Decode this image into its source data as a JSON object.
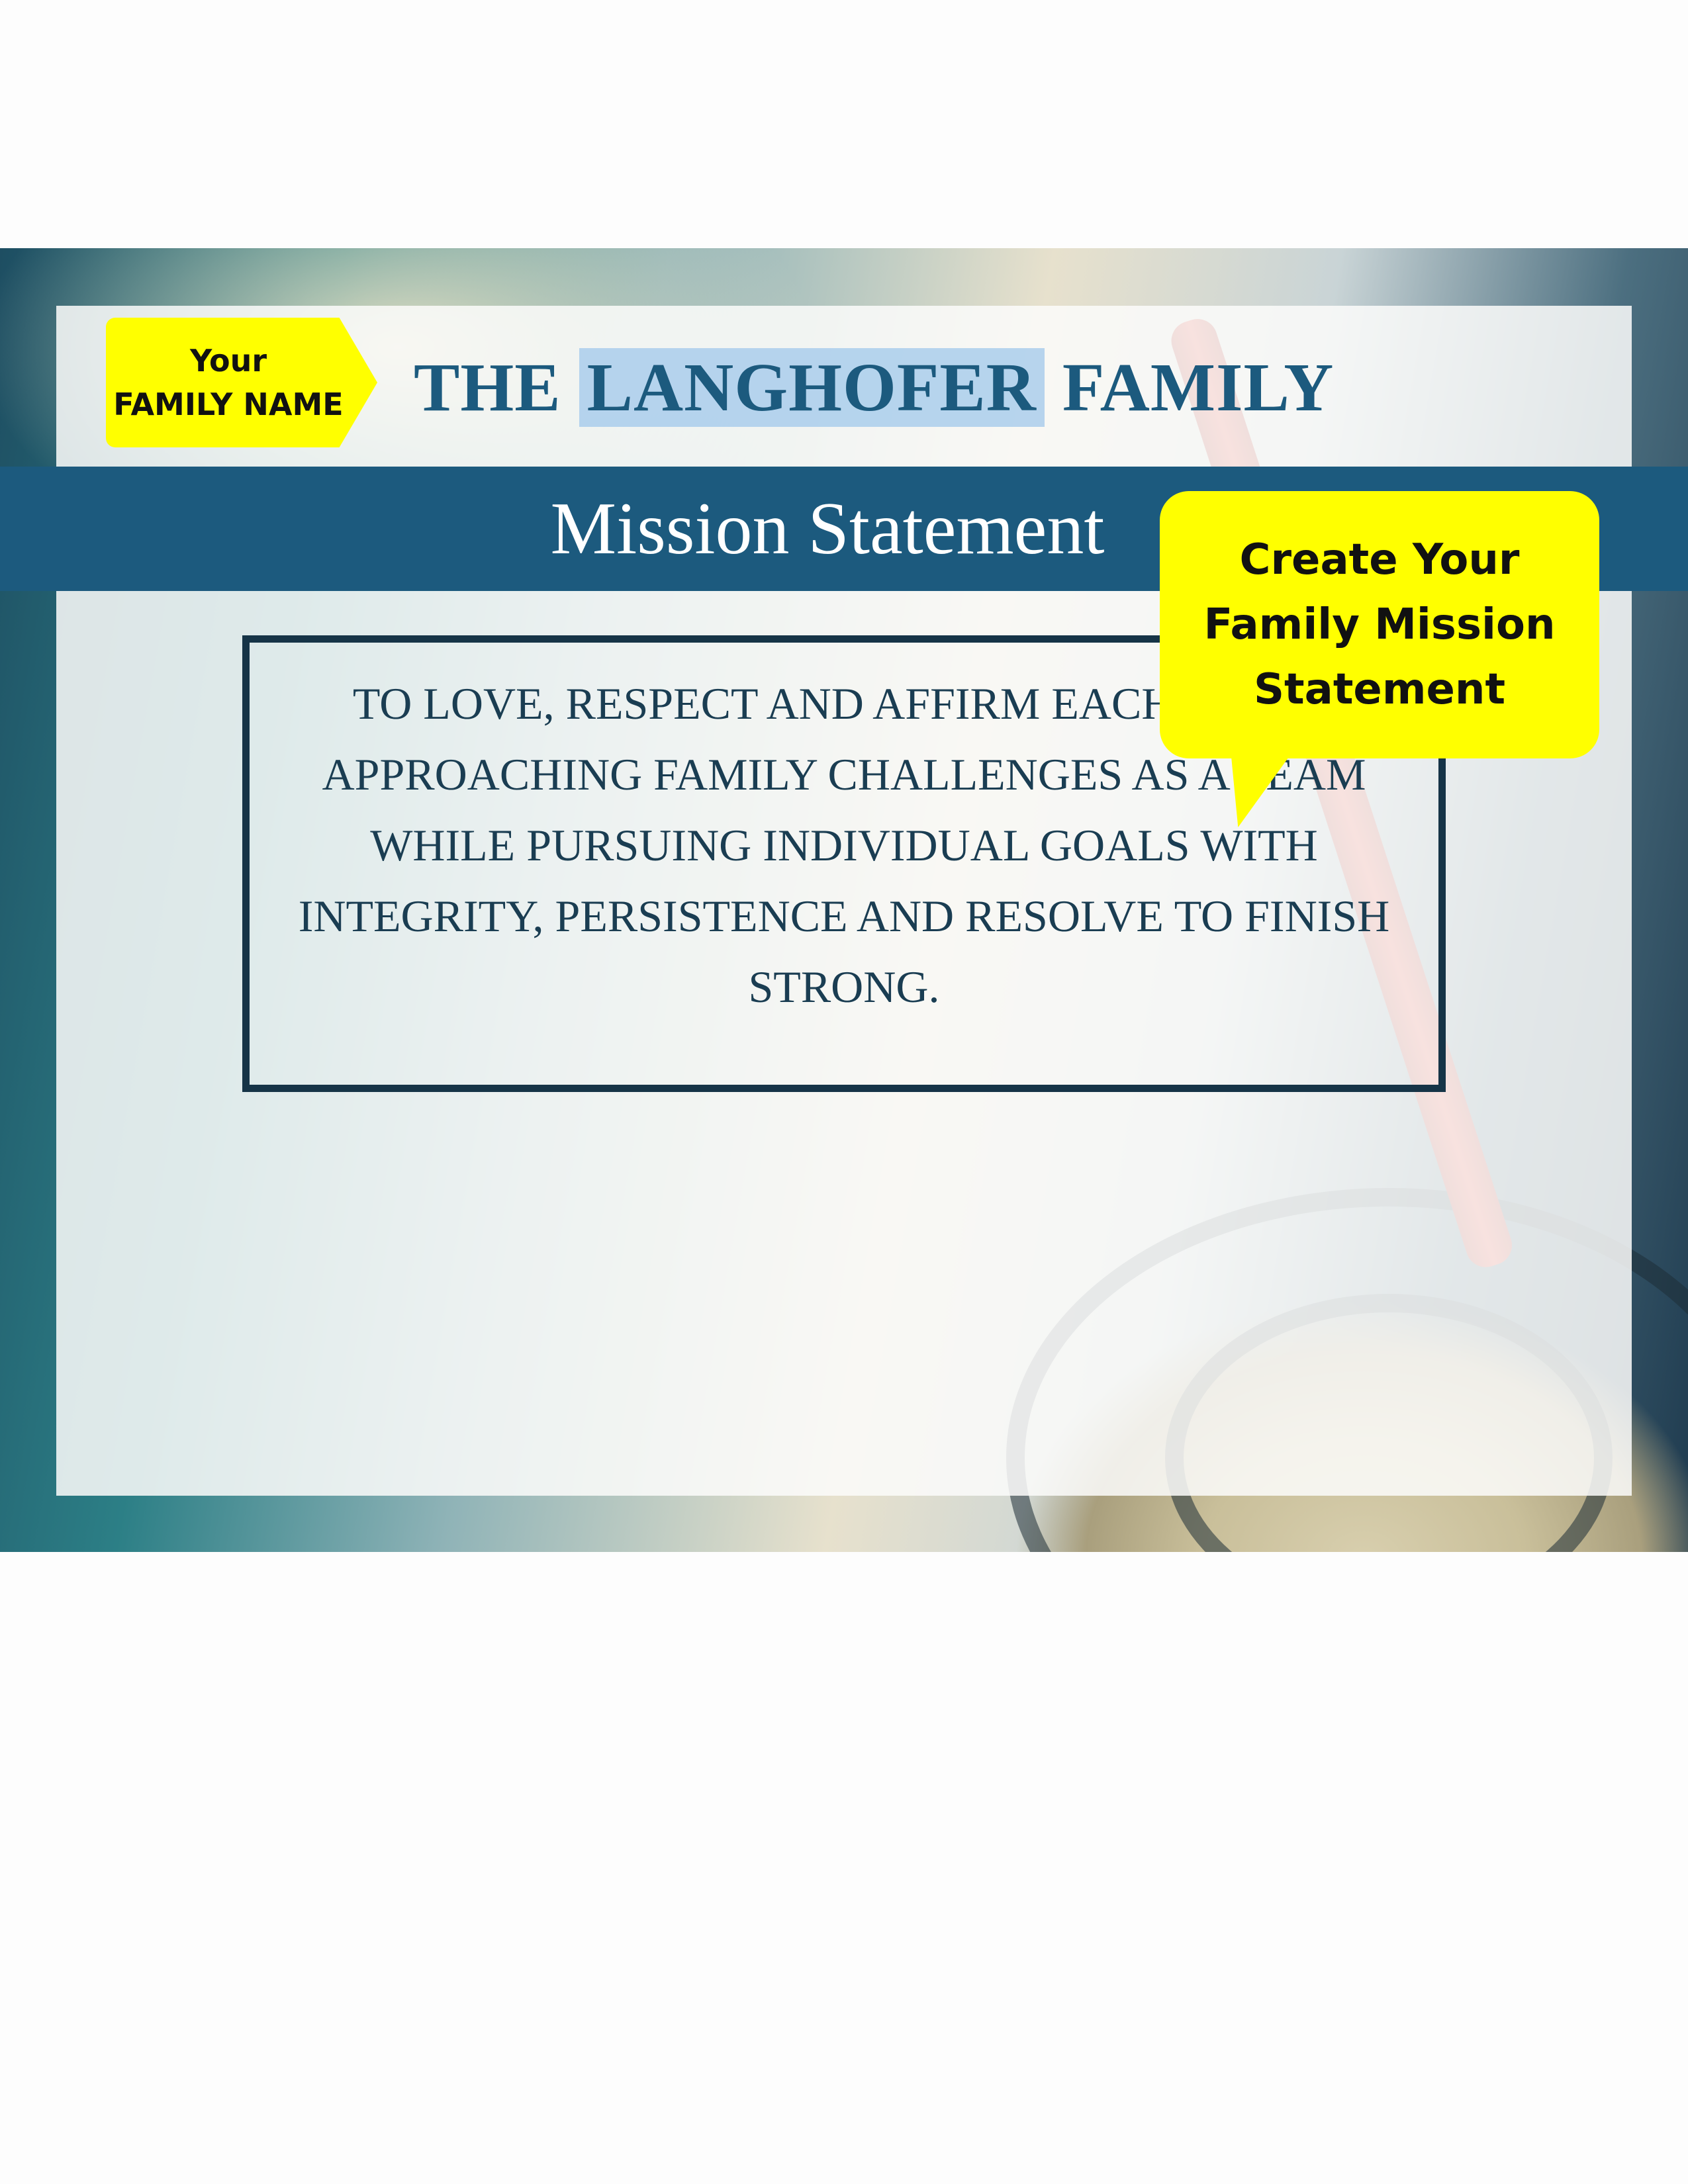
{
  "tag": {
    "line1": "Your",
    "line2": "FAMILY NAME"
  },
  "header": {
    "prefix": "THE ",
    "family_name": "LANGHOFER",
    "suffix": " FAMILY"
  },
  "banner": {
    "title": "Mission Statement"
  },
  "callout": {
    "text": "Create Your Family Mission Statement"
  },
  "mission": {
    "text": "TO LOVE, RESPECT AND AFFIRM EACH OTHER APPROACHING FAMILY CHALLENGES AS A TEAM WHILE PURSUING INDIVIDUAL GOALS WITH INTEGRITY, PERSISTENCE AND RESOLVE TO FINISH STRONG."
  },
  "colors": {
    "accent": "#1c5a7e",
    "highlight": "#ffff00",
    "box_border": "#163447"
  }
}
